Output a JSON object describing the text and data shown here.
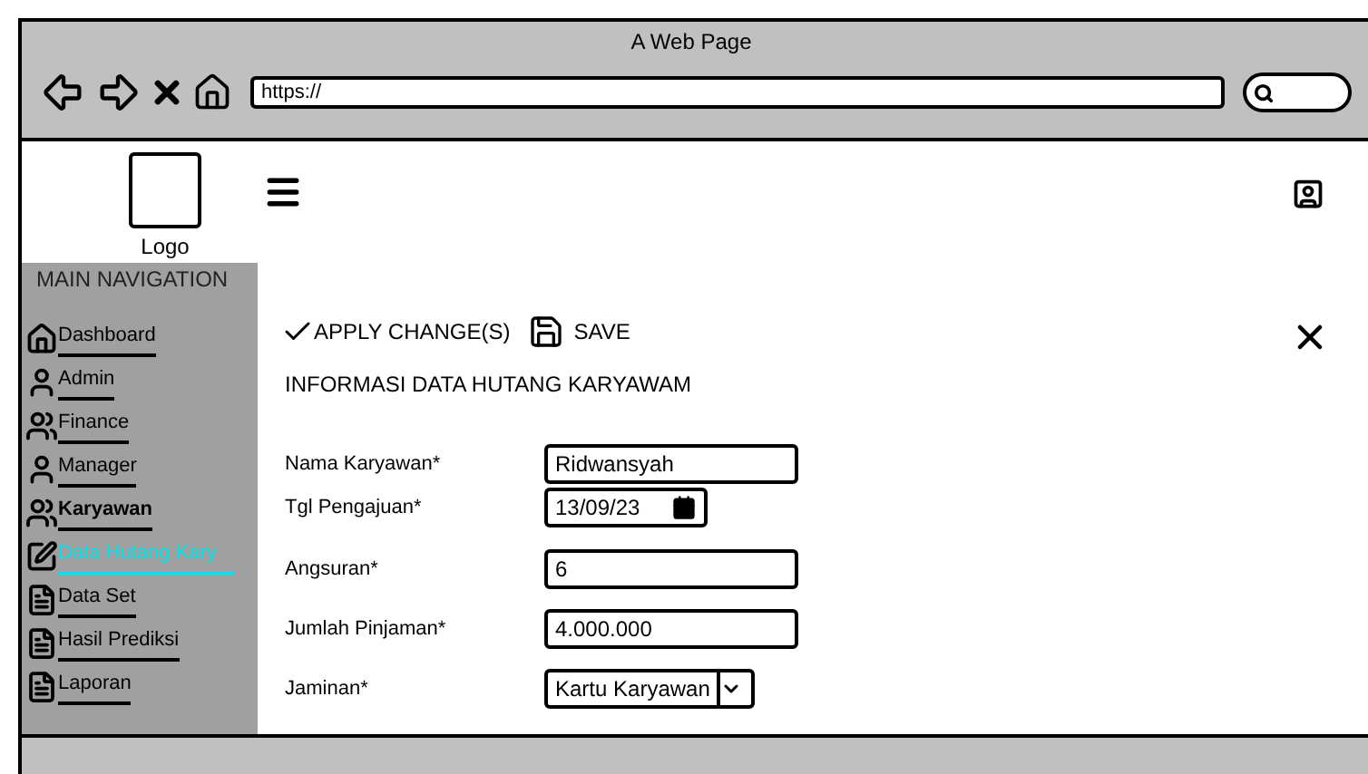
{
  "browser": {
    "title": "A Web Page",
    "url": "https://"
  },
  "header": {
    "logo_label": "Logo"
  },
  "sidebar": {
    "heading": "MAIN NAVIGATION",
    "items": [
      {
        "label": "Dashboard",
        "selected": false,
        "bold": false
      },
      {
        "label": "Admin",
        "selected": false,
        "bold": false
      },
      {
        "label": "Finance",
        "selected": false,
        "bold": false
      },
      {
        "label": "Manager",
        "selected": false,
        "bold": false
      },
      {
        "label": "Karyawan",
        "selected": false,
        "bold": true
      },
      {
        "label": "Data Hutang Kary",
        "selected": true,
        "bold": false
      },
      {
        "label": "Data Set",
        "selected": false,
        "bold": false
      },
      {
        "label": "Hasil Prediksi",
        "selected": false,
        "bold": false
      },
      {
        "label": "Laporan",
        "selected": false,
        "bold": false
      }
    ]
  },
  "toolbar": {
    "apply": "APPLY CHANGE(S)",
    "save": "SAVE"
  },
  "form": {
    "title": "INFORMASI DATA HUTANG KARYAWAM",
    "fields": [
      {
        "label": "Nama Karyawan*",
        "kind": "text",
        "value": "Ridwansyah"
      },
      {
        "label": "Tgl Pengajuan*",
        "kind": "date",
        "value": "13/09/23"
      },
      {
        "label": "Angsuran*",
        "kind": "text",
        "value": "6"
      },
      {
        "label": "Jumlah Pinjaman*",
        "kind": "text",
        "value": "4.000.000"
      },
      {
        "label": "Jaminan*",
        "kind": "select",
        "value": "Kartu Karyawan"
      }
    ]
  }
}
